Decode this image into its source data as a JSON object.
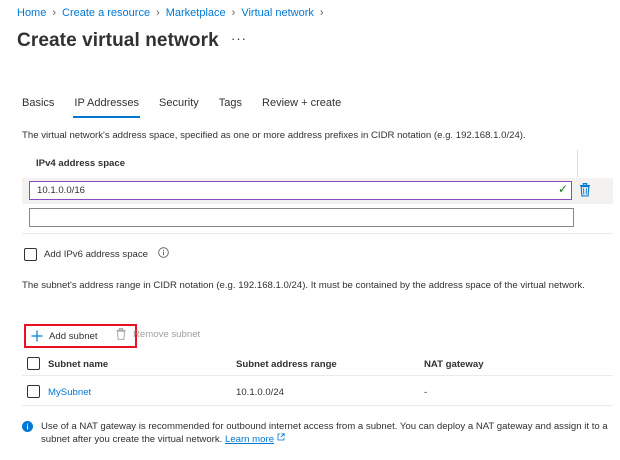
{
  "breadcrumb": [
    "Home",
    "Create a resource",
    "Marketplace",
    "Virtual network"
  ],
  "page": {
    "title": "Create virtual network",
    "more": "···"
  },
  "tabs": [
    {
      "label": "Basics",
      "active": false
    },
    {
      "label": "IP Addresses",
      "active": true
    },
    {
      "label": "Security",
      "active": false
    },
    {
      "label": "Tags",
      "active": false
    },
    {
      "label": "Review + create",
      "active": false
    }
  ],
  "address_space": {
    "description": "The virtual network's address space, specified as one or more address prefixes in CIDR notation (e.g. 192.168.1.0/24).",
    "column_header": "IPv4 address space",
    "values": [
      "10.1.0.0/16",
      ""
    ]
  },
  "ipv6": {
    "label": "Add IPv6 address space",
    "checked": false
  },
  "subnet_info": "The subnet's address range in CIDR notation (e.g. 192.168.1.0/24). It must be contained by the address space of the virtual network.",
  "toolbar": {
    "add_subnet": "Add subnet",
    "remove_subnet": "Remove subnet"
  },
  "subnet_table": {
    "headers": [
      "Subnet name",
      "Subnet address range",
      "NAT gateway"
    ],
    "rows": [
      {
        "name": "MySubnet",
        "range": "10.1.0.0/24",
        "nat": "-"
      }
    ]
  },
  "note": {
    "text": "Use of a NAT gateway is recommended for outbound internet access from a subnet. You can deploy a NAT gateway and assign it to a subnet after you create the virtual network.",
    "link": "Learn more"
  },
  "colors": {
    "accent": "#0078d4",
    "valid": "#107c10",
    "highlight": "#e81123",
    "focus_border": "#8a4bbf"
  },
  "icons": [
    "chevron-right-icon",
    "ellipsis-icon",
    "checkmark-icon",
    "delete-icon",
    "info-icon",
    "add-icon",
    "external-link-icon"
  ]
}
